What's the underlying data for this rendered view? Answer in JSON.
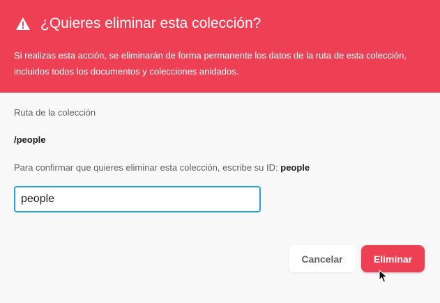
{
  "dialog": {
    "title": "¿Quieres eliminar esta colección?",
    "warning_icon": "warning-triangle-icon",
    "description": "Si realizas esta acción, se eliminarán de forma permanente los datos de la ruta de esta colección, incluidos todos los documentos y colecciones anidados.",
    "path_label": "Ruta de la colección",
    "path_value": "/people",
    "confirm_text": "Para confirmar que quieres eliminar esta colección, escribe su ID:",
    "confirm_id": "people",
    "input_value": "people",
    "cancel_label": "Cancelar",
    "delete_label": "Eliminar"
  },
  "colors": {
    "accent": "#ee4055",
    "input_focus": "#21a3db"
  }
}
